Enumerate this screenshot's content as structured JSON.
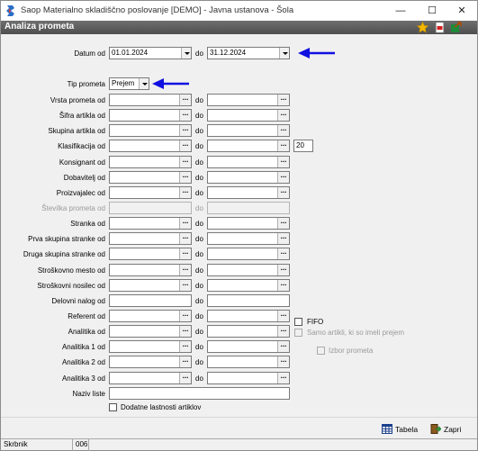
{
  "window": {
    "title": "Saop Materialno skladiščno poslovanje [DEMO] - Javna ustanova - Šola",
    "minimize": "—",
    "maximize": "☐",
    "close": "✕"
  },
  "header": {
    "title": "Analiza prometa",
    "icons": [
      "star-icon",
      "pdf-icon",
      "export-icon"
    ]
  },
  "form": {
    "datum_od_label": "Datum od",
    "datum_od_value": "01.01.2024",
    "datum_do_value": "31.12.2024",
    "do_label": "do",
    "tip_prometa_label": "Tip prometa",
    "tip_prometa_value": "Prejem",
    "rows": [
      {
        "label": "Vrsta prometa od",
        "do": "do"
      },
      {
        "label": "Šifra artikla od",
        "do": "do"
      },
      {
        "label": "Skupina artikla od",
        "do": "do"
      },
      {
        "label": "Klasifikacija od",
        "do": "do",
        "extra": "20"
      },
      {
        "label": "Konsignant od",
        "do": "do"
      },
      {
        "label": "Dobavitelj od",
        "do": "do"
      },
      {
        "label": "Proizvajalec od",
        "do": "do"
      },
      {
        "label": "Številka prometa od",
        "do": "do",
        "disabled": true
      },
      {
        "label": "Stranka od",
        "do": "do"
      },
      {
        "label": "Prva skupina stranke od",
        "do": "do"
      },
      {
        "label": "Druga skupina stranke od",
        "do": "do"
      },
      {
        "label": "Stroškovno mesto od",
        "do": "do"
      },
      {
        "label": "Stroškovni nosilec od",
        "do": "do"
      },
      {
        "label": "Delovni nalog od",
        "do": "do",
        "plain": true
      },
      {
        "label": "Referent od",
        "do": "do"
      },
      {
        "label": "Analitika od",
        "do": "do"
      },
      {
        "label": "Analitika 1 od",
        "do": "do"
      },
      {
        "label": "Analitika 2 od",
        "do": "do"
      },
      {
        "label": "Analitika 3 od",
        "do": "do"
      }
    ],
    "naziv_liste_label": "Naziv liste",
    "naziv_liste_value": "",
    "dodatne_label": "Dodatne lastnosti artiklov",
    "fifo_label": "FIFO",
    "samo_artikli_label": "Samo artikli, ki so imeli prejem",
    "izbor_prometa_label": "Izbor prometa",
    "ellipsis": "..."
  },
  "buttons": {
    "tabela_label": "Tabela",
    "zapri_label": "Zapri"
  },
  "status": {
    "user": "Skrbnik",
    "code": "006"
  },
  "colors": {
    "subbar": "#555555",
    "arrow": "#1010e0",
    "star": "#f4b800"
  }
}
